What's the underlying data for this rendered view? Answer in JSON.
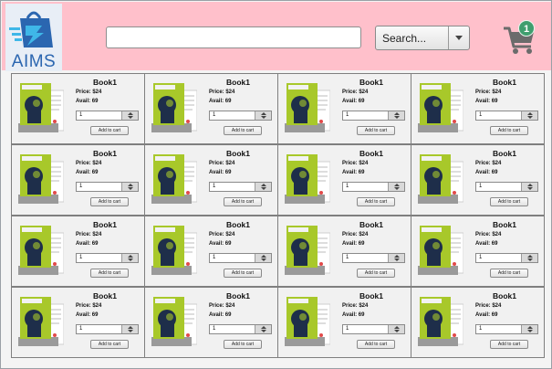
{
  "header": {
    "logo_text": "AIMS",
    "search_input_value": "",
    "search_input_placeholder": "",
    "search_select_value": "Search...",
    "cart_count": "1"
  },
  "colors": {
    "header_bg": "#ffc0cb",
    "logo_blue": "#2b66b0",
    "cart_badge": "#3f9e6e",
    "cover_green": "#a8c82a"
  },
  "icons": {
    "logo": "shopping-bag-icon",
    "cart": "shopping-cart-icon",
    "dropdown": "chevron-down-icon"
  },
  "products": [
    {
      "title": "Book1",
      "price": "Price: $24",
      "avail": "Avail: 69",
      "qty": "1",
      "button": "Add to cart"
    },
    {
      "title": "Book1",
      "price": "Price: $24",
      "avail": "Avail: 69",
      "qty": "1",
      "button": "Add to cart"
    },
    {
      "title": "Book1",
      "price": "Price: $24",
      "avail": "Avail: 69",
      "qty": "1",
      "button": "Add to cart"
    },
    {
      "title": "Book1",
      "price": "Price: $24",
      "avail": "Avail: 69",
      "qty": "1",
      "button": "Add to cart"
    },
    {
      "title": "Book1",
      "price": "Price: $24",
      "avail": "Avail: 69",
      "qty": "1",
      "button": "Add to cart"
    },
    {
      "title": "Book1",
      "price": "Price: $24",
      "avail": "Avail: 69",
      "qty": "1",
      "button": "Add to cart"
    },
    {
      "title": "Book1",
      "price": "Price: $24",
      "avail": "Avail: 69",
      "qty": "1",
      "button": "Add to cart"
    },
    {
      "title": "Book1",
      "price": "Price: $24",
      "avail": "Avail: 69",
      "qty": "1",
      "button": "Add to cart"
    },
    {
      "title": "Book1",
      "price": "Price: $24",
      "avail": "Avail: 69",
      "qty": "1",
      "button": "Add to cart"
    },
    {
      "title": "Book1",
      "price": "Price: $24",
      "avail": "Avail: 69",
      "qty": "1",
      "button": "Add to cart"
    },
    {
      "title": "Book1",
      "price": "Price: $24",
      "avail": "Avail: 69",
      "qty": "1",
      "button": "Add to cart"
    },
    {
      "title": "Book1",
      "price": "Price: $24",
      "avail": "Avail: 69",
      "qty": "1",
      "button": "Add to cart"
    },
    {
      "title": "Book1",
      "price": "Price: $24",
      "avail": "Avail: 69",
      "qty": "1",
      "button": "Add to cart"
    },
    {
      "title": "Book1",
      "price": "Price: $24",
      "avail": "Avail: 69",
      "qty": "1",
      "button": "Add to cart"
    },
    {
      "title": "Book1",
      "price": "Price: $24",
      "avail": "Avail: 69",
      "qty": "1",
      "button": "Add to cart"
    },
    {
      "title": "Book1",
      "price": "Price: $24",
      "avail": "Avail: 69",
      "qty": "1",
      "button": "Add to cart"
    }
  ]
}
